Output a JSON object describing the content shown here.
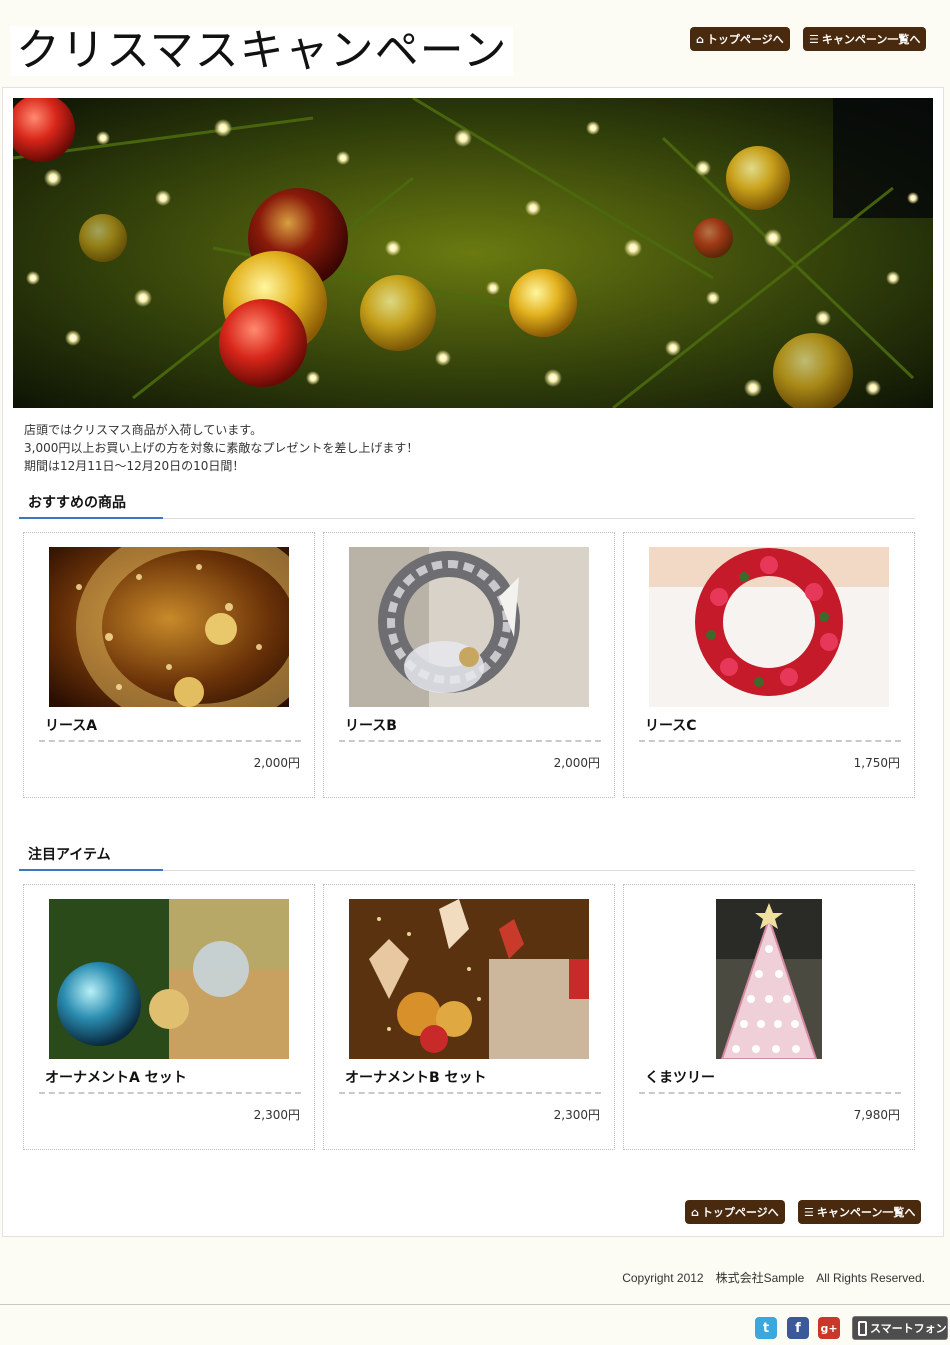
{
  "header": {
    "site_title": "クリスマスキャンペーン",
    "top_button": "トップページへ",
    "list_button": "キャンペーン一覧へ"
  },
  "intro": {
    "line1": "店頭ではクリスマス商品が入荷しています。",
    "line2": "3,000円以上お買い上げの方を対象に素敵なプレゼントを差し上げます！",
    "line3": "期間は12月11日～12月20日の10日間！"
  },
  "recommended": {
    "heading": "おすすめの商品",
    "items": [
      {
        "name": "リースA",
        "price": "2,000円"
      },
      {
        "name": "リースB",
        "price": "2,000円"
      },
      {
        "name": "リースC",
        "price": "1,750円"
      }
    ]
  },
  "featured": {
    "heading": "注目アイテム",
    "items": [
      {
        "name": "オーナメントA セット",
        "price": "2,300円"
      },
      {
        "name": "オーナメントB セット",
        "price": "2,300円"
      },
      {
        "name": "くまツリー",
        "price": "7,980円"
      }
    ]
  },
  "bottom_nav": {
    "top_button": "トップページへ",
    "list_button": "キャンペーン一覧へ"
  },
  "footer": {
    "copyright": "Copyright 2012　株式会社Sample　All Rights Reserved.",
    "smartphone_button": "スマートフォン",
    "social_icons": [
      "twitter-icon",
      "facebook-icon",
      "google-plus-icon"
    ]
  },
  "colors": {
    "button_bg": "#4a2a0e",
    "section_accent": "#3a76c2",
    "page_bg": "#fdfcf4"
  }
}
